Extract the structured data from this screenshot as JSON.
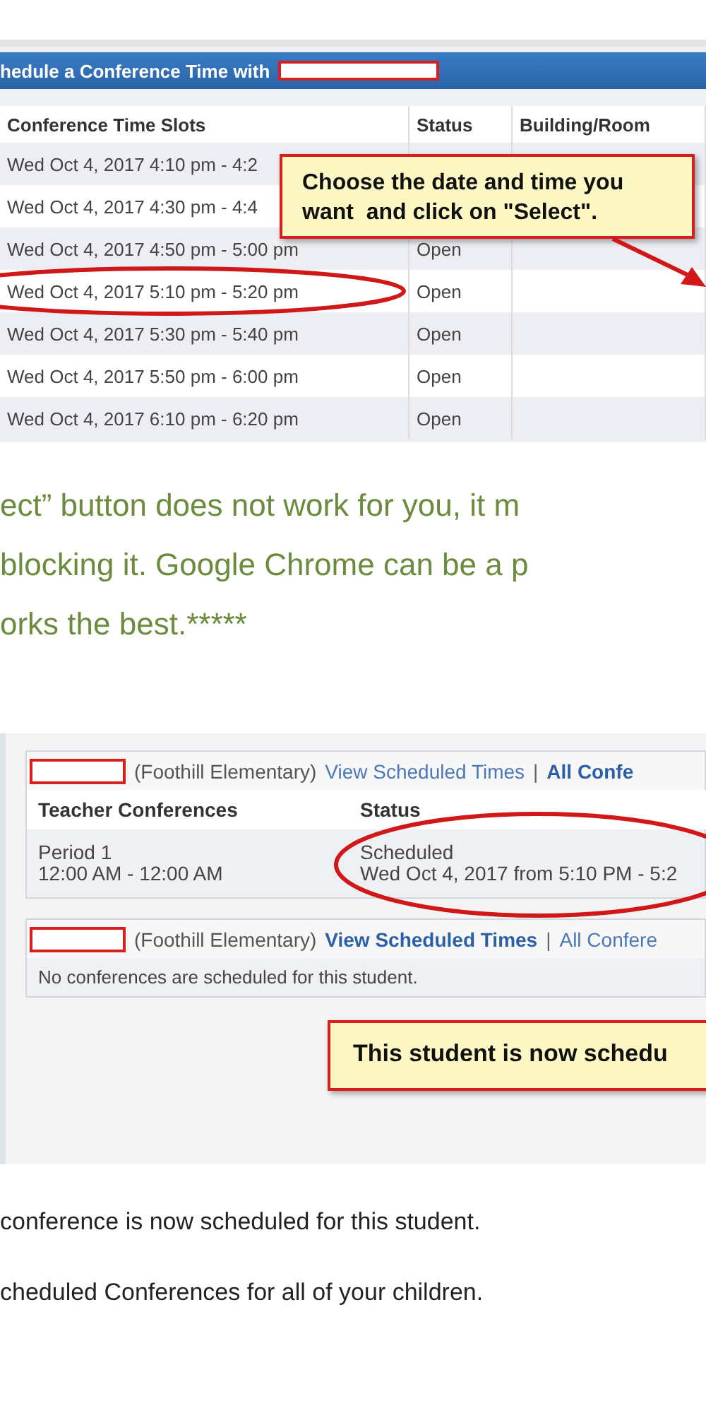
{
  "scheduler": {
    "title": "hedule a Conference Time with",
    "columns": [
      "Conference Time Slots",
      "Status",
      "Building/Room"
    ],
    "rows": [
      {
        "slot": "Wed Oct 4, 2017 4:10 pm - 4:2",
        "circled": false
      },
      {
        "slot": "Wed Oct 4, 2017 4:30 pm - 4:4",
        "circled": false
      },
      {
        "slot": "Wed Oct 4, 2017 4:50 pm - 5:00 pm",
        "status": "Open",
        "circled": false
      },
      {
        "slot": "Wed Oct 4, 2017 5:10 pm - 5:20 pm",
        "status": "Open",
        "circled": true
      },
      {
        "slot": "Wed Oct 4, 2017 5:30 pm - 5:40 pm",
        "status": "Open",
        "circled": false
      },
      {
        "slot": "Wed Oct 4, 2017 5:50 pm - 6:00 pm",
        "status": "Open",
        "circled": false
      },
      {
        "slot": "Wed Oct 4, 2017 6:10 pm - 6:20 pm",
        "status": "Open",
        "circled": false
      }
    ],
    "callout": "Choose the date and time you want  and click on \"Select\"."
  },
  "note_lines": [
    "ect” button does not work for you, it m",
    "blocking it.  Google Chrome can be a p",
    "orks the best.*****"
  ],
  "students": [
    {
      "school": "(Foothill Elementary)",
      "separator": "|",
      "links": [
        {
          "label": "View Scheduled Times",
          "bold": false
        },
        {
          "label": "All Confe",
          "bold": true
        }
      ],
      "columns": [
        "Teacher Conferences",
        "Status"
      ],
      "rows": [
        {
          "conference": [
            "Period 1",
            "12:00 AM - 12:00 AM"
          ],
          "status": [
            "Scheduled",
            "Wed Oct 4, 2017 from 5:10 PM - 5:2"
          ],
          "circled": true
        }
      ]
    },
    {
      "school": "(Foothill Elementary)",
      "separator": "|",
      "links": [
        {
          "label": "View Scheduled Times",
          "bold": true
        },
        {
          "label": "All Confere",
          "bold": false
        }
      ],
      "message": "No conferences are scheduled for this student."
    }
  ],
  "student_callout": "This student is now schedu",
  "footer_lines": [
    "conference is now scheduled for this student.",
    "cheduled Conferences for all of your children."
  ]
}
